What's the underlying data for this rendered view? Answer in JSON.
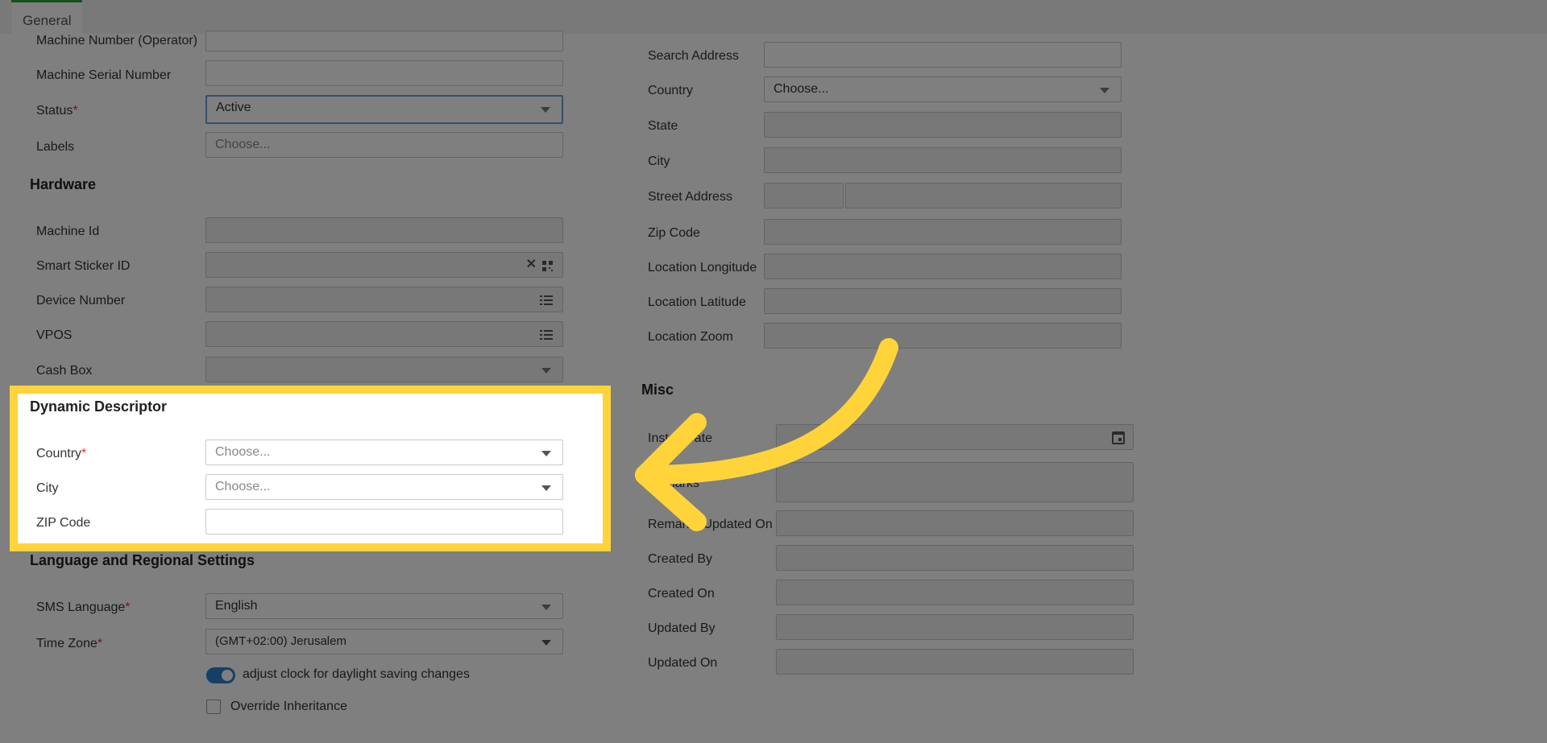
{
  "tabs": [
    {
      "label": "General"
    }
  ],
  "machine": {
    "machine_number_label": "Machine Number (Operator)",
    "serial_label": "Machine Serial Number",
    "status_label": "Status",
    "status_value": "Active",
    "labels_label": "Labels",
    "labels_placeholder": "Choose..."
  },
  "hardware": {
    "title": "Hardware",
    "machine_id_label": "Machine Id",
    "smart_sticker_label": "Smart Sticker ID",
    "device_number_label": "Device Number",
    "vpos_label": "VPOS",
    "cash_box_label": "Cash Box"
  },
  "dynamic_descriptor": {
    "title": "Dynamic Descriptor",
    "country_label": "Country",
    "country_placeholder": "Choose...",
    "city_label": "City",
    "city_placeholder": "Choose...",
    "zip_label": "ZIP Code"
  },
  "language": {
    "title": "Language and Regional Settings",
    "sms_label": "SMS Language",
    "sms_value": "English",
    "timezone_label": "Time Zone",
    "timezone_value": "(GMT+02:00) Jerusalem",
    "dst_label": "adjust clock for daylight saving changes",
    "dst_on": true,
    "override_label": "Override Inheritance",
    "override_checked": false
  },
  "address": {
    "search_label": "Search Address",
    "country_label": "Country",
    "country_placeholder": "Choose...",
    "state_label": "State",
    "city_label": "City",
    "street_label": "Street Address",
    "zip_label": "Zip Code",
    "longitude_label": "Location Longitude",
    "latitude_label": "Location Latitude",
    "zoom_label": "Location Zoom"
  },
  "misc": {
    "title": "Misc",
    "install_date_label": "Install Date",
    "remarks_label": "Remarks",
    "remarks_updated_label": "Remarks Updated On",
    "created_by_label": "Created By",
    "created_on_label": "Created On",
    "updated_by_label": "Updated By",
    "updated_on_label": "Updated On"
  },
  "required_mark": "*",
  "colors": {
    "highlight": "#ffd43b",
    "arrow": "#ffd43b",
    "tab_accent": "#2e9e3e",
    "toggle": "#2a80c8"
  }
}
